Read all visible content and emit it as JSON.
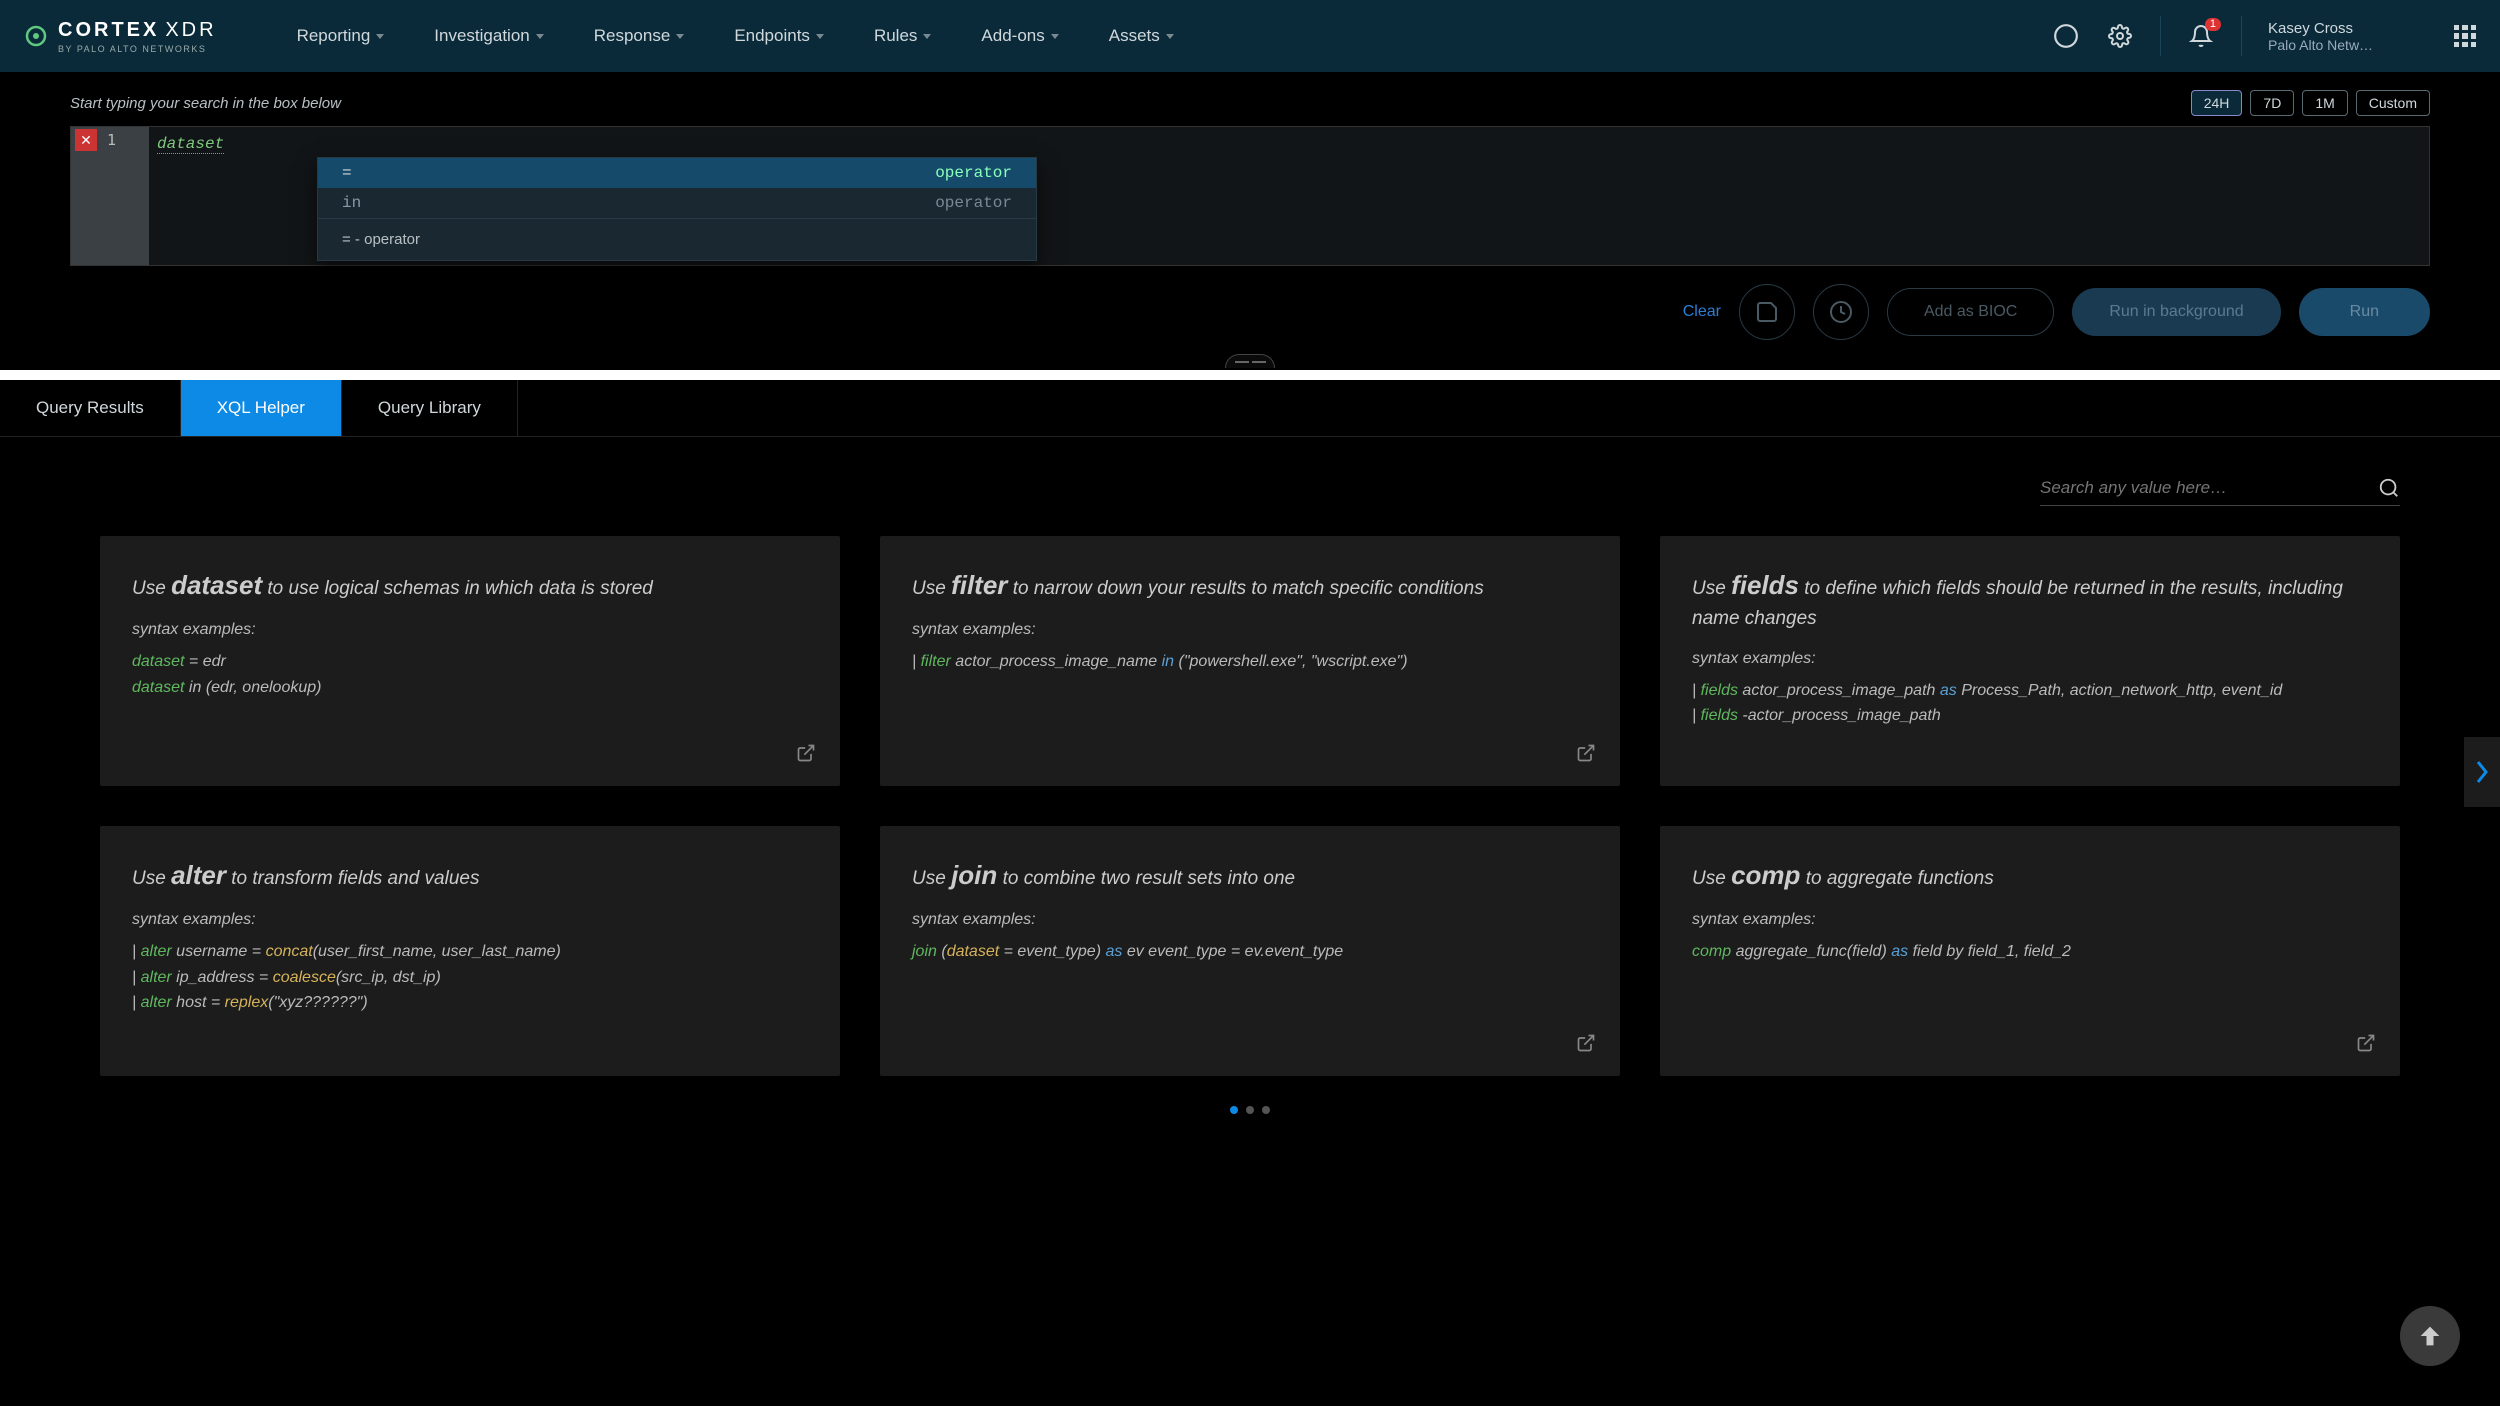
{
  "brand": {
    "name": "CORTEX",
    "suffix": "XDR",
    "byline": "BY PALO ALTO NETWORKS"
  },
  "nav": {
    "items": [
      "Reporting",
      "Investigation",
      "Response",
      "Endpoints",
      "Rules",
      "Add-ons",
      "Assets"
    ]
  },
  "notifications": {
    "count": "1"
  },
  "user": {
    "name": "Kasey Cross",
    "tenant": "Palo Alto Netw…"
  },
  "search": {
    "hint": "Start typing your search in the box below",
    "line_number": "1",
    "query_token": "dataset",
    "time_options": [
      "24H",
      "7D",
      "1M",
      "Custom"
    ],
    "time_active": "24H"
  },
  "autocomplete": {
    "rows": [
      {
        "label": "=",
        "type": "operator",
        "selected": true
      },
      {
        "label": "in",
        "type": "operator",
        "selected": false
      }
    ],
    "hint_label": "=",
    "hint_sep": " - ",
    "hint_text": "operator"
  },
  "actions": {
    "clear": "Clear",
    "add_bioc": "Add as BIOC",
    "run_bg": "Run in background",
    "run": "Run"
  },
  "tabs": {
    "items": [
      "Query Results",
      "XQL Helper",
      "Query Library"
    ],
    "active": "XQL Helper"
  },
  "helper": {
    "search_placeholder": "Search any value here…",
    "syntax_label": "syntax examples:",
    "cards": [
      {
        "pre": "Use ",
        "kw": "dataset",
        "post": " to use logical schemas in which data is stored",
        "examples": [
          [
            {
              "t": "dataset",
              "c": "g"
            },
            {
              "t": " = edr",
              "c": ""
            }
          ],
          [
            {
              "t": "dataset",
              "c": "g"
            },
            {
              "t": " in (edr, onelookup)",
              "c": ""
            }
          ]
        ],
        "has_link": true
      },
      {
        "pre": "Use ",
        "kw": "filter",
        "post": " to narrow down your results to match specific conditions",
        "examples": [
          [
            {
              "t": "| ",
              "c": ""
            },
            {
              "t": "filter",
              "c": "g"
            },
            {
              "t": " actor_process_image_name ",
              "c": ""
            },
            {
              "t": "in",
              "c": "b"
            },
            {
              "t": " (\"powershell.exe\", \"wscript.exe\")",
              "c": ""
            }
          ]
        ],
        "has_link": true
      },
      {
        "pre": "Use ",
        "kw": "fields",
        "post": " to define which fields should be returned in the results, including name changes",
        "examples": [
          [
            {
              "t": "| ",
              "c": ""
            },
            {
              "t": "fields",
              "c": "g"
            },
            {
              "t": " actor_process_image_path ",
              "c": ""
            },
            {
              "t": "as",
              "c": "b"
            },
            {
              "t": " Process_Path, action_network_http, event_id",
              "c": ""
            }
          ],
          [
            {
              "t": "| ",
              "c": ""
            },
            {
              "t": "fields",
              "c": "g"
            },
            {
              "t": " -actor_process_image_path",
              "c": ""
            }
          ]
        ],
        "has_link": false
      },
      {
        "pre": "Use ",
        "kw": "alter",
        "post": " to transform fields and values",
        "examples": [
          [
            {
              "t": "| ",
              "c": ""
            },
            {
              "t": "alter",
              "c": "g"
            },
            {
              "t": " username = ",
              "c": ""
            },
            {
              "t": "concat",
              "c": "y"
            },
            {
              "t": "(user_first_name, user_last_name)",
              "c": ""
            }
          ],
          [
            {
              "t": "| ",
              "c": ""
            },
            {
              "t": "alter",
              "c": "g"
            },
            {
              "t": " ip_address = ",
              "c": ""
            },
            {
              "t": "coalesce",
              "c": "y"
            },
            {
              "t": "(src_ip, dst_ip)",
              "c": ""
            }
          ],
          [
            {
              "t": "| ",
              "c": ""
            },
            {
              "t": "alter",
              "c": "g"
            },
            {
              "t": " host = ",
              "c": ""
            },
            {
              "t": "replex",
              "c": "y"
            },
            {
              "t": "(\"xyz??????\")",
              "c": ""
            }
          ]
        ],
        "has_link": false
      },
      {
        "pre": "Use ",
        "kw": "join",
        "post": " to combine two result sets into one",
        "examples": [
          [
            {
              "t": "join",
              "c": "g"
            },
            {
              "t": " (",
              "c": ""
            },
            {
              "t": "dataset",
              "c": "y"
            },
            {
              "t": " = event_type) ",
              "c": ""
            },
            {
              "t": "as",
              "c": "b"
            },
            {
              "t": " ev event_type = ev.event_type",
              "c": ""
            }
          ]
        ],
        "has_link": true
      },
      {
        "pre": "Use ",
        "kw": "comp",
        "post": " to aggregate functions",
        "examples": [
          [
            {
              "t": "comp",
              "c": "g"
            },
            {
              "t": " aggregate_func(field) ",
              "c": ""
            },
            {
              "t": "as",
              "c": "b"
            },
            {
              "t": " field by field_1, field_2",
              "c": ""
            }
          ]
        ],
        "has_link": true
      }
    ]
  }
}
